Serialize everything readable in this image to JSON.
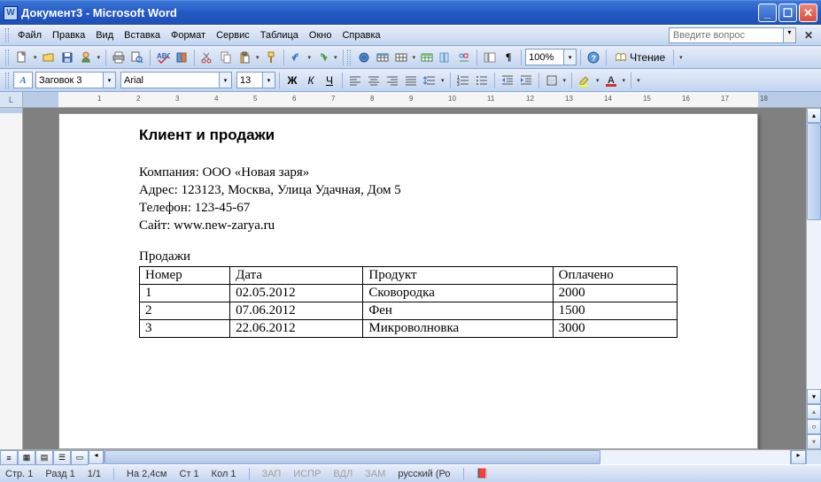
{
  "title": "Документ3 - Microsoft Word",
  "menus": [
    "Файл",
    "Правка",
    "Вид",
    "Вставка",
    "Формат",
    "Сервис",
    "Таблица",
    "Окно",
    "Справка"
  ],
  "help_placeholder": "Введите вопрос",
  "zoom": "100%",
  "reading_label": "Чтение",
  "format_toolbar": {
    "style_glyph": "A",
    "style_name": "Заговок 3",
    "font_name": "Arial",
    "font_size": "13"
  },
  "document": {
    "heading": "Клиент и продажи",
    "info_lines": [
      "Компания: ООО «Новая заря»",
      "Адрес: 123123, Москва, Улица Удачная, Дом 5",
      "Телефон: 123-45-67",
      "Сайт: www.new-zarya.ru"
    ],
    "section_label": "Продажи",
    "table": {
      "headers": [
        "Номер",
        "Дата",
        "Продукт",
        "Оплачено"
      ],
      "rows": [
        [
          "1",
          "02.05.2012",
          "Сковородка",
          "2000"
        ],
        [
          "2",
          "07.06.2012",
          "Фен",
          "1500"
        ],
        [
          "3",
          "22.06.2012",
          "Микроволновка",
          "3000"
        ]
      ]
    }
  },
  "status": {
    "page": "Стр. 1",
    "section": "Разд 1",
    "pages": "1/1",
    "at": "На 2,4см",
    "line": "Ст 1",
    "col": "Кол 1",
    "rec": "ЗАП",
    "trk": "ИСПР",
    "ext": "ВДЛ",
    "ovr": "ЗАМ",
    "lang": "русский (Ро"
  }
}
